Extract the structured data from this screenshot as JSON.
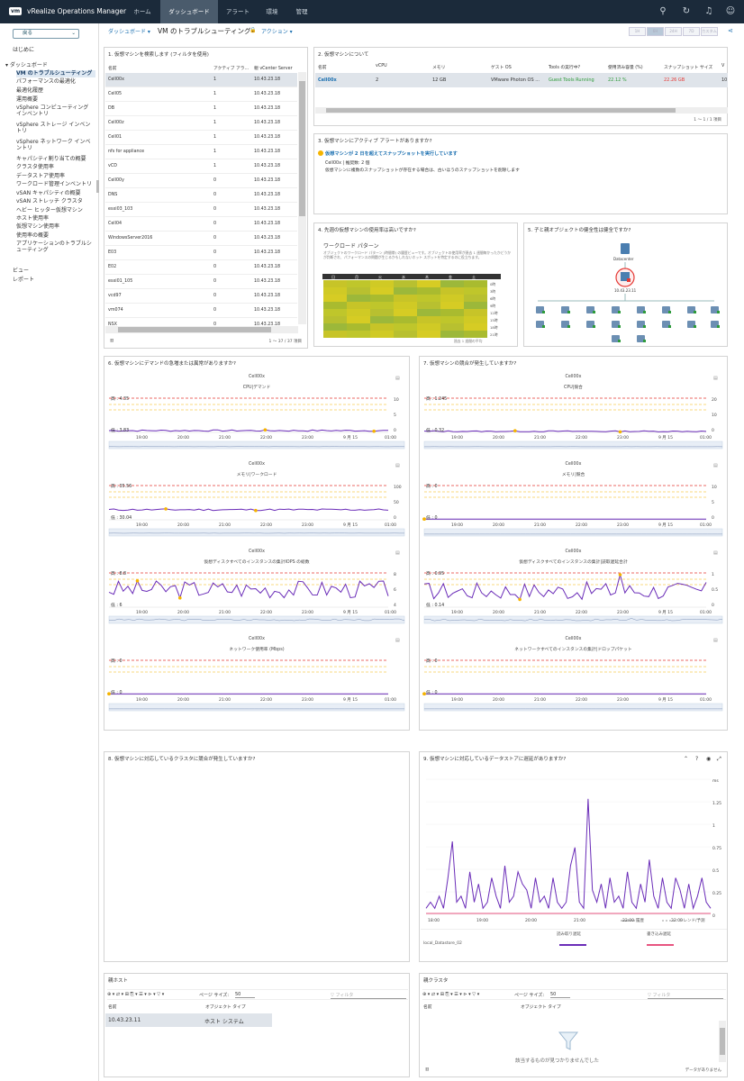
{
  "app": {
    "logo": "vm",
    "title": "vRealize Operations Manager"
  },
  "nav": {
    "home": "ホーム",
    "dashboards": "ダッシュボード",
    "alerts": "アラート",
    "environment": "環境",
    "admin": "管理"
  },
  "sidebar": {
    "back": "戻る",
    "getting_started": "はじめに",
    "dashboards_header": "ダッシュボード",
    "items": [
      "VM のトラブルシューティング",
      "パフォーマンスの最適化",
      "最適化履歴",
      "運用概要",
      "vSphere コンピューティング インベントリ",
      "vSphere ストレージ インベントリ",
      "vSphere ネットワーク インベントリ",
      "キャパシティ割り当ての概要",
      "クラスタ使用率",
      "データストア使用率",
      "ワークロード管理インベントリ",
      "vSAN キャパシティの概要",
      "vSAN ストレッチ クラスタ",
      "ヘビー ヒッター仮想マシン",
      "ホスト使用率",
      "仮想マシン使用率",
      "使用率の概要",
      "アプリケーションのトラブルシューティング"
    ],
    "views": "ビュー",
    "reports": "レポート"
  },
  "toolbar": {
    "dashboard_menu": "ダッシュボード ▾",
    "page_title": "VM のトラブルシューティング",
    "actions": "アクション ▾",
    "time_buttons": [
      "1H",
      "6H",
      "24H",
      "7D",
      "カスタム"
    ]
  },
  "p1": {
    "title": "1. 仮想マシンを検索します (フィルタを使用)",
    "headers": [
      "名前",
      "アクティブ アラ...",
      "親 vCenter Server"
    ],
    "rows": [
      [
        "Cell00x",
        "1",
        "10.43.23.18"
      ],
      [
        "Cell05",
        "1",
        "10.43.23.18"
      ],
      [
        "DB",
        "1",
        "10.43.23.18"
      ],
      [
        "Cell00z",
        "1",
        "10.43.23.18"
      ],
      [
        "Cell01",
        "1",
        "10.43.23.18"
      ],
      [
        "nfs for appliance",
        "1",
        "10.43.23.18"
      ],
      [
        "vCD",
        "1",
        "10.43.23.18"
      ],
      [
        "Cell00y",
        "0",
        "10.43.23.18"
      ],
      [
        "DNS",
        "0",
        "10.43.23.18"
      ],
      [
        "esxi03_103",
        "0",
        "10.43.23.18"
      ],
      [
        "Cell04",
        "0",
        "10.43.23.18"
      ],
      [
        "WindowsServer2016",
        "0",
        "10.43.23.18"
      ],
      [
        "E03",
        "0",
        "10.43.23.18"
      ],
      [
        "E02",
        "0",
        "10.43.23.18"
      ],
      [
        "esxi01_105",
        "0",
        "10.43.23.18"
      ],
      [
        "vcd97",
        "0",
        "10.43.23.18"
      ],
      [
        "vm074",
        "0",
        "10.43.23.18"
      ],
      [
        "NSX",
        "0",
        "10.43.23.18"
      ]
    ],
    "footer": "1 ～ 37 / 37 項目"
  },
  "p2": {
    "title": "2. 仮想マシンについて",
    "headers": [
      "名前",
      "vCPU",
      "メモリ",
      "ゲスト OS",
      "Tools の実行中?",
      "使用済み容量 (%)",
      "スナップショット サイズ",
      "V"
    ],
    "row": [
      "Cell00x",
      "2",
      "12 GB",
      "VMware Photon OS ...",
      "Guest Tools Running",
      "22.12 %",
      "22.26 GB",
      "10"
    ],
    "footer": "1 ～ 1 / 1 項目"
  },
  "p3": {
    "title": "3. 仮想マシンにアクティブ アラートがありますか?",
    "alert": "仮想マシンが 2 日を超えてスナップショットを実行しています",
    "detail1": "Cell00x | 推奨数: 2 個",
    "detail2": "仮想マシンに複数のスナップショットが存在する場合は、古いほうのスナップショットを削除します"
  },
  "p4": {
    "title": "4. 先週の仮想マシンの使用率は高いですか?",
    "heading": "ワークロード パターン",
    "desc": "オブジェクトのワークロード パターン (時間帯) の履歴ビューです。オブジェクトの使用率が過去 1 週間毎かったかどうかが判断され、パフォーマンスの問題が生じるかもしれないホット スポットを特定するのに役立ちます。",
    "days": [
      "日",
      "月",
      "火",
      "水",
      "木",
      "金",
      "土"
    ],
    "hours": [
      "0時",
      "3時",
      "6時",
      "9時",
      "12時",
      "15時",
      "18時",
      "21時"
    ],
    "footer": "過去 1 週間の平均"
  },
  "p5": {
    "title": "5. 子と親オブジェクトの健全性は健全ですか?",
    "datacenter": "Datacenter",
    "vm_label": "10.43.23.11"
  },
  "p6": {
    "title": "6. 仮想マシンにデマンドの急増または異常がありますか?",
    "object": "Cell00x",
    "charts": [
      {
        "title": "CPU|デマンド",
        "high": "高 : 4.35",
        "low": "低 : 3.83",
        "yticks": [
          "10",
          "5",
          "0"
        ]
      },
      {
        "title": "メモリ|ワークロード",
        "high": "高 : 35.56",
        "low": "低 : 30.04",
        "yticks": [
          "100",
          "50",
          "0"
        ]
      },
      {
        "title": "仮想ディスクすべてのインスタンスの集計IOPS の総数",
        "high": "高 : 8.8",
        "low": "低 : 6",
        "yticks": [
          "8",
          "6",
          "4"
        ]
      },
      {
        "title": "ネットワーク使用率 (Mbps)",
        "high": "高 : 0",
        "low": "低 : 0",
        "yticks": [
          "",
          "",
          ""
        ]
      }
    ],
    "xticks": [
      "19:00",
      "20:00",
      "21:00",
      "22:00",
      "23:00",
      "9 月 15",
      "01:00"
    ]
  },
  "p7": {
    "title": "7. 仮想マシンの競合が発生していますか?",
    "object": "Cell00x",
    "charts": [
      {
        "title": "CPU|競合",
        "high": "高 : 1.245",
        "low": "低 : 0.32",
        "yticks": [
          "20",
          "10",
          "0"
        ]
      },
      {
        "title": "メモリ|競合",
        "high": "高 : 0",
        "low": "低 : 0",
        "yticks": [
          "10",
          "5",
          "0"
        ]
      },
      {
        "title": "仮想ディスクすべてのインスタンスの集計|読取遅延合計",
        "high": "高 : 0.95",
        "low": "低 : 0.14",
        "yticks": [
          "1",
          "0.5",
          "0"
        ]
      },
      {
        "title": "ネットワークすべてのインスタンスの集計|ドロップパケット",
        "high": "高 : 0",
        "low": "低 : 0",
        "yticks": [
          "",
          "",
          ""
        ]
      }
    ],
    "xticks": [
      "19:00",
      "20:00",
      "21:00",
      "22:00",
      "23:00",
      "9 月 15",
      "01:00"
    ]
  },
  "p8": {
    "title": "8. 仮想マシンに対応しているクラスタに競合が発生していますか?"
  },
  "p9": {
    "title": "9. 仮想マシンに対応しているデータストアに遅延がありますか?",
    "yticks": [
      "ms",
      "1.25",
      "1",
      "0.75",
      "0.5",
      "0.25",
      "0"
    ],
    "xticks": [
      "18:00",
      "19:00",
      "20:00",
      "21:00",
      "22:00",
      "23:00"
    ],
    "legend_history": "履歴",
    "legend_trend": "トレンド/予測",
    "col_read": "読み取り遅延",
    "col_write": "書き込み遅延",
    "datastore": "local_Datastore_02"
  },
  "host": {
    "title": "親ホスト",
    "page_size_label": "ページ サイズ:",
    "page_size": "50",
    "filter": "フィルタ",
    "headers": [
      "名前",
      "オブジェクト タイプ"
    ],
    "row": [
      "10.43.23.11",
      "ホスト システム"
    ]
  },
  "cluster": {
    "title": "親クラスタ",
    "page_size_label": "ページ サイズ:",
    "page_size": "50",
    "filter": "フィルタ",
    "headers": [
      "名前",
      "オブジェクト タイプ"
    ],
    "empty": "該当するものが見つかりませんでした",
    "footer": "データがありません"
  },
  "colors": {
    "topbar": "#1b2a3a",
    "accent": "#1a6fb0",
    "series": "#6a2cb8",
    "high": "#e53935",
    "low": "#f5b400"
  }
}
